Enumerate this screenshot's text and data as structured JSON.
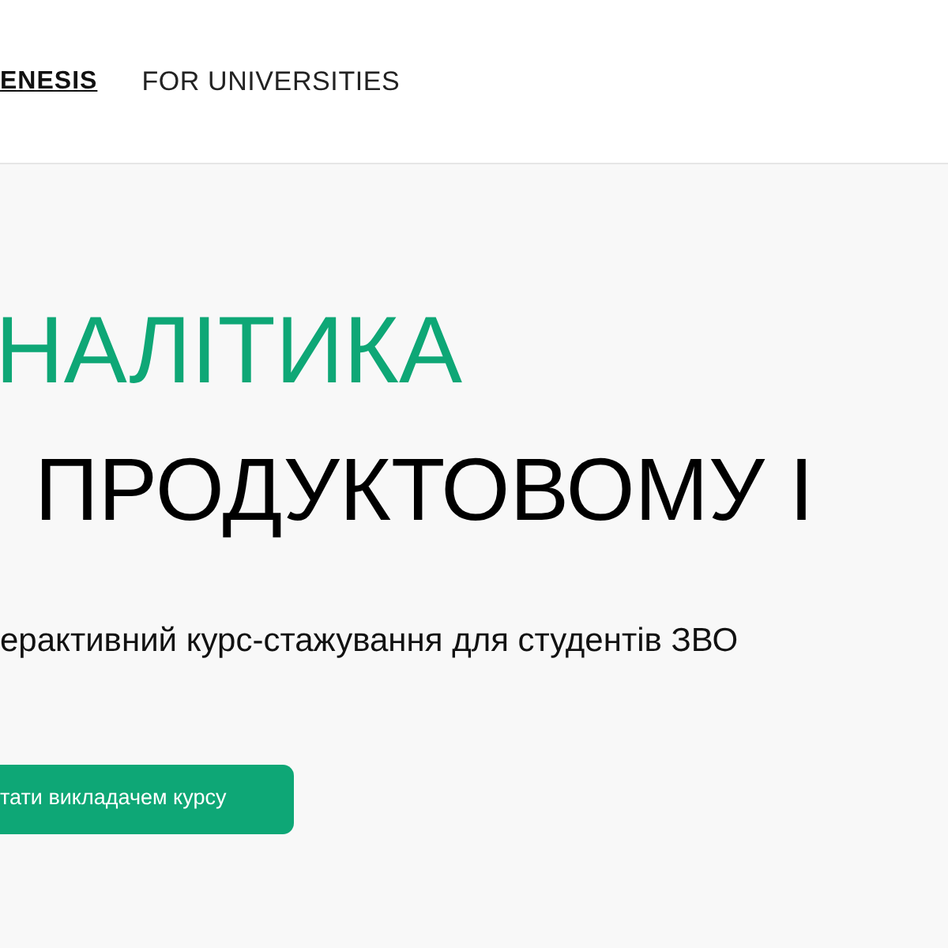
{
  "header": {
    "logo": "ENESIS",
    "nav": [
      "FOR UNIVERSITIES"
    ]
  },
  "hero": {
    "title_accent": "НАЛІТИКА",
    "title": "ПРОДУКТОВОМУ І",
    "subtitle": "ерактивний курс-стажування для студентів ЗВО",
    "button": "тати викладачем курсу"
  }
}
